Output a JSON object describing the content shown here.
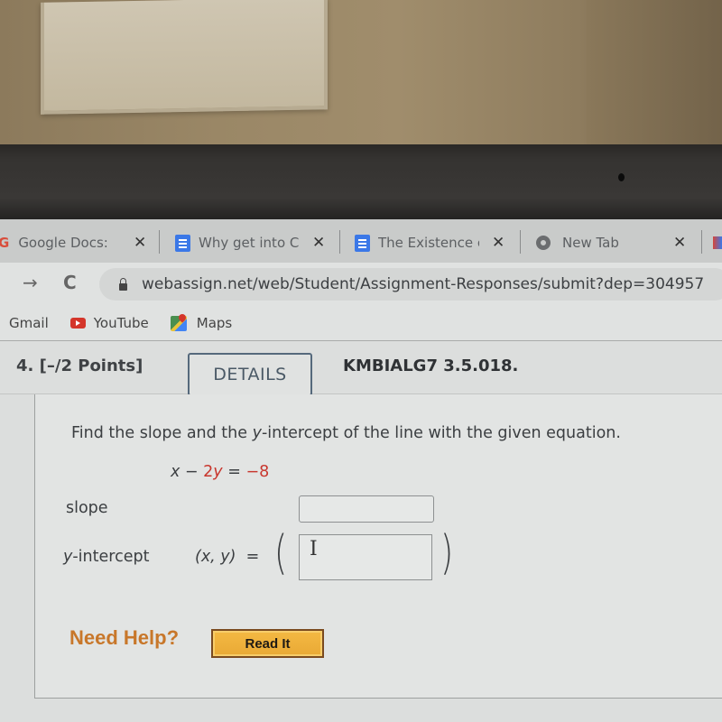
{
  "browser": {
    "tabs": [
      {
        "label": "Google Docs: C",
        "icon": "google-g-icon",
        "close": "✕"
      },
      {
        "label": "Why get into C",
        "icon": "google-docs-icon",
        "close": "✕"
      },
      {
        "label": "The Existence c",
        "icon": "google-docs-icon",
        "close": "✕"
      },
      {
        "label": "New Tab",
        "icon": "chrome-icon",
        "close": "✕"
      }
    ],
    "nav": {
      "forward": "→",
      "reload": "C"
    },
    "url": "webassign.net/web/Student/Assignment-Responses/submit?dep=304957",
    "bookmarks": [
      {
        "label": "Gmail",
        "icon": "none"
      },
      {
        "label": "YouTube",
        "icon": "youtube-icon"
      },
      {
        "label": "Maps",
        "icon": "maps-icon"
      }
    ]
  },
  "question": {
    "number": "4.",
    "points": "[–/2 Points]",
    "details_label": "DETAILS",
    "code": "KMBIALG7 3.5.018.",
    "prompt_before": "Find the slope and the ",
    "prompt_var": "y",
    "prompt_after": "-intercept of the line with the given equation.",
    "equation": {
      "lhs_x": "x",
      "minus": " − ",
      "coef": "2",
      "var_y": "y",
      "equals": " = ",
      "rhs": "−8"
    },
    "slope_label": "slope",
    "slope_value": "",
    "intercept_label_var": "y",
    "intercept_label_rest": "-intercept",
    "point_notation": "(x, y)  =",
    "open_paren": "(",
    "close_paren": ")",
    "intercept_value": "",
    "cursor_glyph": "I",
    "need_help": "Need Help?",
    "read_it": "Read It"
  }
}
